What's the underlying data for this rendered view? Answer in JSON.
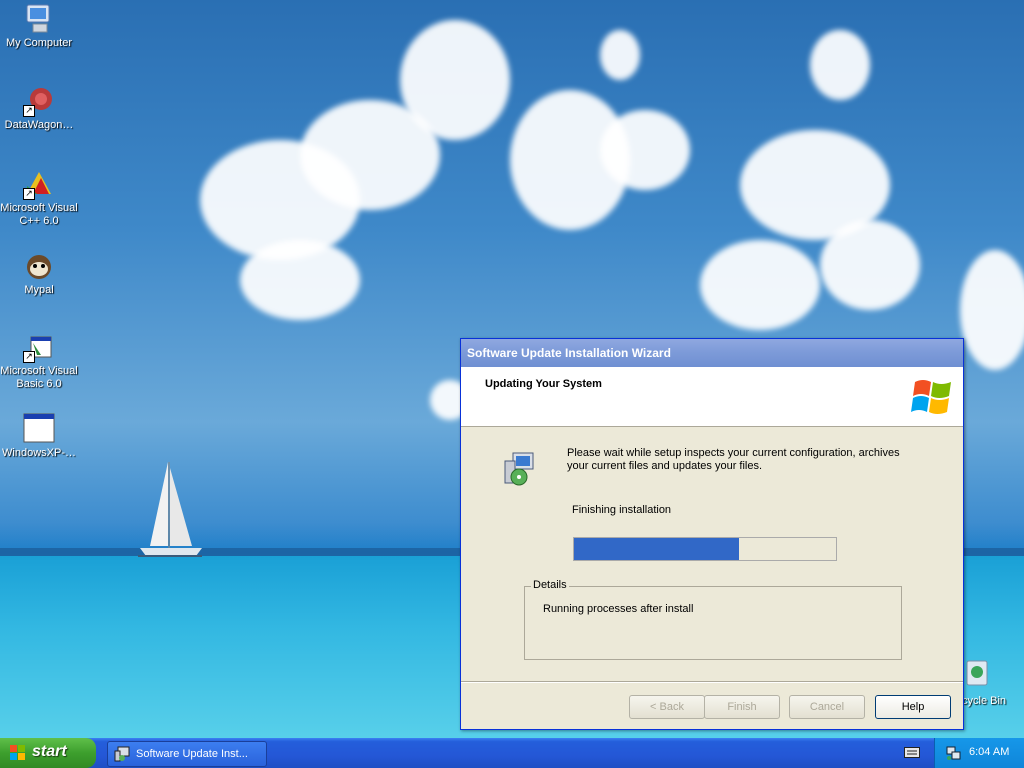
{
  "desktop": {
    "icons": [
      {
        "label": "My Computer",
        "icon": "computer-icon"
      },
      {
        "label": "DataWagon…",
        "icon": "datawagon-icon"
      },
      {
        "label": "Microsoft Visual C++ 6.0",
        "icon": "visual-cpp-icon"
      },
      {
        "label": "Mypal",
        "icon": "mypal-icon"
      },
      {
        "label": "Microsoft Visual Basic 6.0",
        "icon": "visual-basic-icon"
      },
      {
        "label": "WindowsXP-…",
        "icon": "window-icon"
      }
    ],
    "recycle_bin_label": "cycle Bin"
  },
  "wizard": {
    "title": "Software Update Installation Wizard",
    "header_title": "Updating Your System",
    "description": "Please wait while setup inspects your current configuration, archives your current files and updates your files.",
    "status": "Finishing installation",
    "progress_percent": 63,
    "details_legend": "Details",
    "details_text": "Running processes after install",
    "buttons": {
      "back": "< Back",
      "finish": "Finish",
      "cancel": "Cancel",
      "help": "Help"
    }
  },
  "taskbar": {
    "start_label": "start",
    "task_label": "Software Update Inst...",
    "clock": "6:04 AM"
  }
}
